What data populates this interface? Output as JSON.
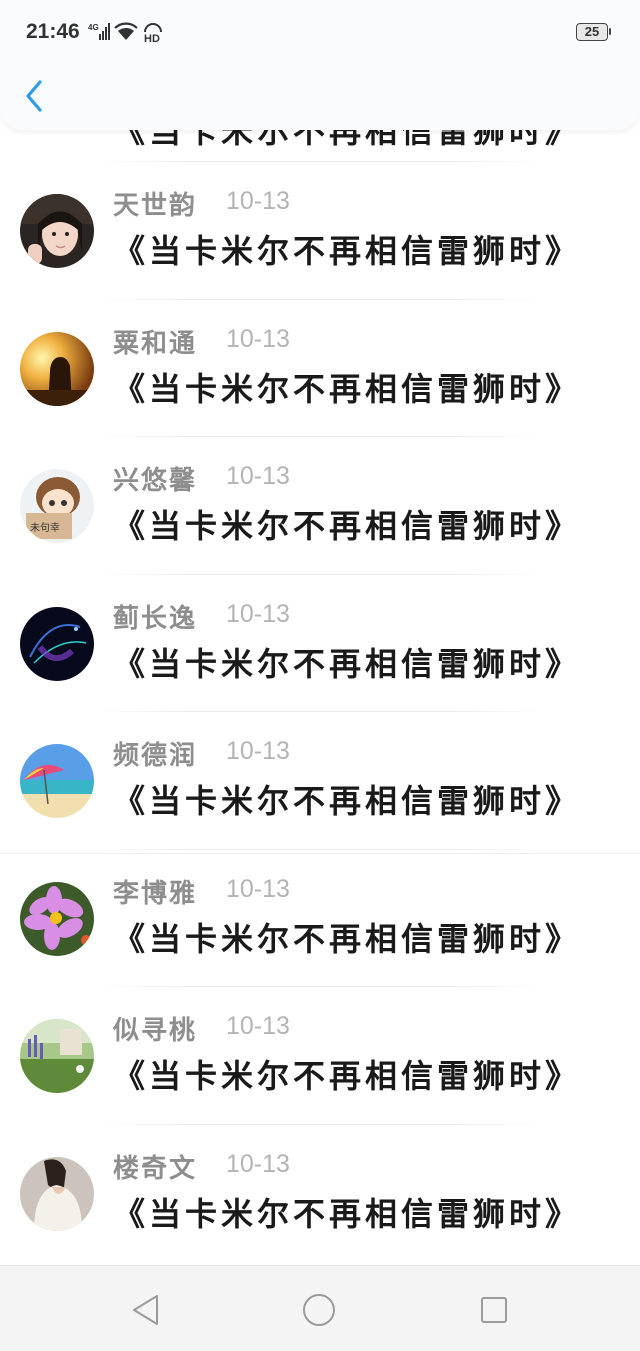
{
  "status_bar": {
    "time": "21:46",
    "network": "4G",
    "hd": "HD",
    "battery": "25"
  },
  "nav": {
    "back_icon": "chevron-left-icon"
  },
  "partial_row": {
    "message": "《当卡米尔不再相信雷狮时》"
  },
  "comments": [
    {
      "name": "天世韵",
      "date": "10-13",
      "message": "《当卡米尔不再相信雷狮时》",
      "avatar": "girl-photo"
    },
    {
      "name": "粟和通",
      "date": "10-13",
      "message": "《当卡米尔不再相信雷狮时》",
      "avatar": "sunset-silhouette"
    },
    {
      "name": "兴悠馨",
      "date": "10-13",
      "message": "《当卡米尔不再相信雷狮时》",
      "avatar": "cartoon-sign"
    },
    {
      "name": "蓟长逸",
      "date": "10-13",
      "message": "《当卡米尔不再相信雷狮时》",
      "avatar": "dark-abstract"
    },
    {
      "name": "频德润",
      "date": "10-13",
      "message": "《当卡米尔不再相信雷狮时》",
      "avatar": "beach-umbrella"
    },
    {
      "name": "李博雅",
      "date": "10-13",
      "message": "《当卡米尔不再相信雷狮时》",
      "avatar": "pink-flower"
    },
    {
      "name": "似寻桃",
      "date": "10-13",
      "message": "《当卡米尔不再相信雷狮时》",
      "avatar": "garden"
    },
    {
      "name": "楼奇文",
      "date": "10-13",
      "message": "《当卡米尔不再相信雷狮时》",
      "avatar": "woman-back"
    }
  ],
  "bottom_nav": {
    "back": "triangle-back-icon",
    "home": "circle-home-icon",
    "recent": "square-recent-icon"
  },
  "colors": {
    "accent": "#2f9be8",
    "name": "#8e8e8e",
    "date": "#b4b4b4",
    "message": "#1a1a1a"
  }
}
